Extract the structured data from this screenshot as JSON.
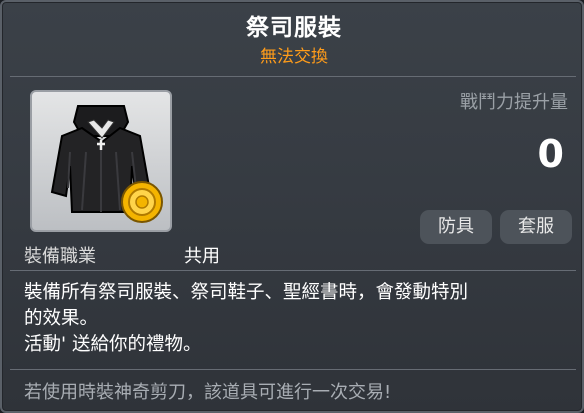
{
  "item": {
    "name": "祭司服裝",
    "trade_status": "無法交換",
    "icon": "black-priest-robe-with-gold-coin-icon"
  },
  "power": {
    "label": "戰鬥力提升量",
    "value": "0"
  },
  "tags": [
    "防具",
    "套服"
  ],
  "job": {
    "label": "裝備職業",
    "value": "共用"
  },
  "description": [
    "裝備所有祭司服裝、祭司鞋子、聖經書時，會發動特別",
    "的效果。",
    "活動' 送給你的禮物。"
  ],
  "note": "若使用時裝神奇剪刀，該道具可進行一次交易!",
  "colors": {
    "background": "#363b42",
    "title": "#ffffff",
    "trade_status": "#ff9c1a",
    "muted": "#9aa0a6"
  }
}
